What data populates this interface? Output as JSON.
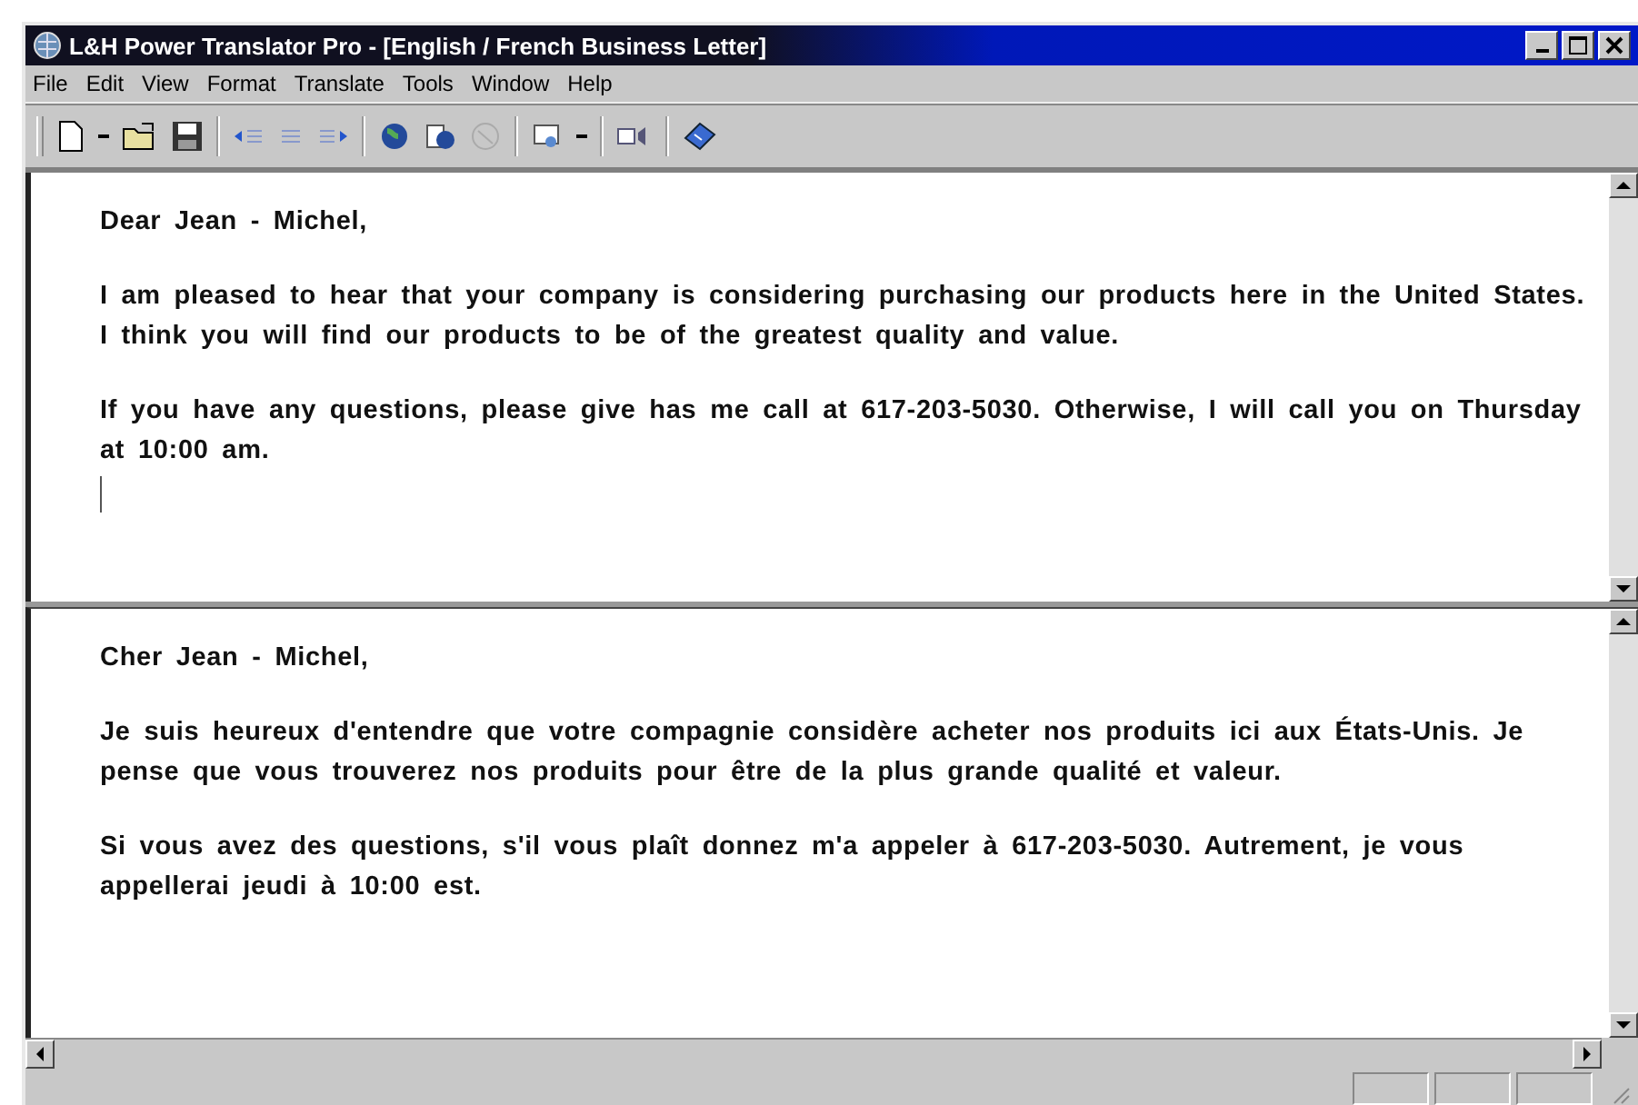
{
  "window": {
    "title": "L&H Power Translator Pro - [English / French Business Letter]"
  },
  "menu": [
    "File",
    "Edit",
    "View",
    "Format",
    "Translate",
    "Tools",
    "Window",
    "Help"
  ],
  "panes": [
    {
      "paragraphs": [
        "Dear Jean - Michel,",
        "I am pleased to hear that your company is considering purchasing our products here in the United States. I think you will find our products to be of the greatest quality and value.",
        "If you have any questions, please give has me call at 617-203-5030. Otherwise, I will call you on Thursday at 10:00 am."
      ],
      "caret": true
    },
    {
      "paragraphs": [
        "Cher Jean - Michel,",
        "Je suis heureux d'entendre que votre compagnie considère acheter nos produits ici aux États-Unis. Je pense que vous trouverez nos produits pour être de la plus grande qualité et valeur.",
        "Si vous avez des questions, s'il vous plaît donnez m'a appeler à 617-203-5030. Autrement, je vous appellerai jeudi à 10:00 est."
      ],
      "caret": false
    }
  ]
}
